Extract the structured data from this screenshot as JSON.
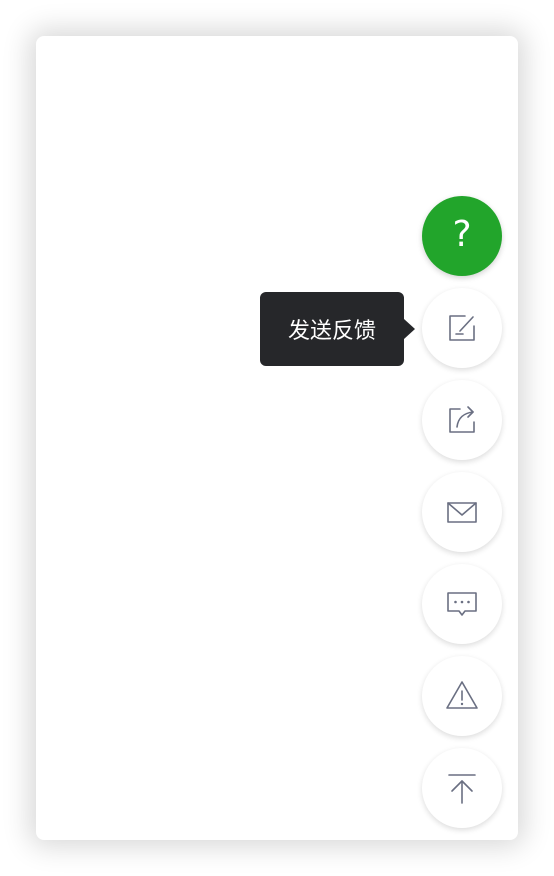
{
  "colors": {
    "accent_green": "#22a52b",
    "tooltip_bg": "#26272a",
    "icon_stroke": "#6a6f82"
  },
  "floating_actions": {
    "help": {
      "glyph": "?",
      "icon": "question-mark-icon"
    },
    "feedback": {
      "icon": "feedback-edit-icon",
      "tooltip": "发送反馈"
    },
    "share": {
      "icon": "share-icon"
    },
    "mail": {
      "icon": "mail-icon"
    },
    "message": {
      "icon": "message-icon"
    },
    "report": {
      "icon": "warning-icon"
    },
    "back_to_top": {
      "icon": "back-to-top-icon"
    }
  }
}
